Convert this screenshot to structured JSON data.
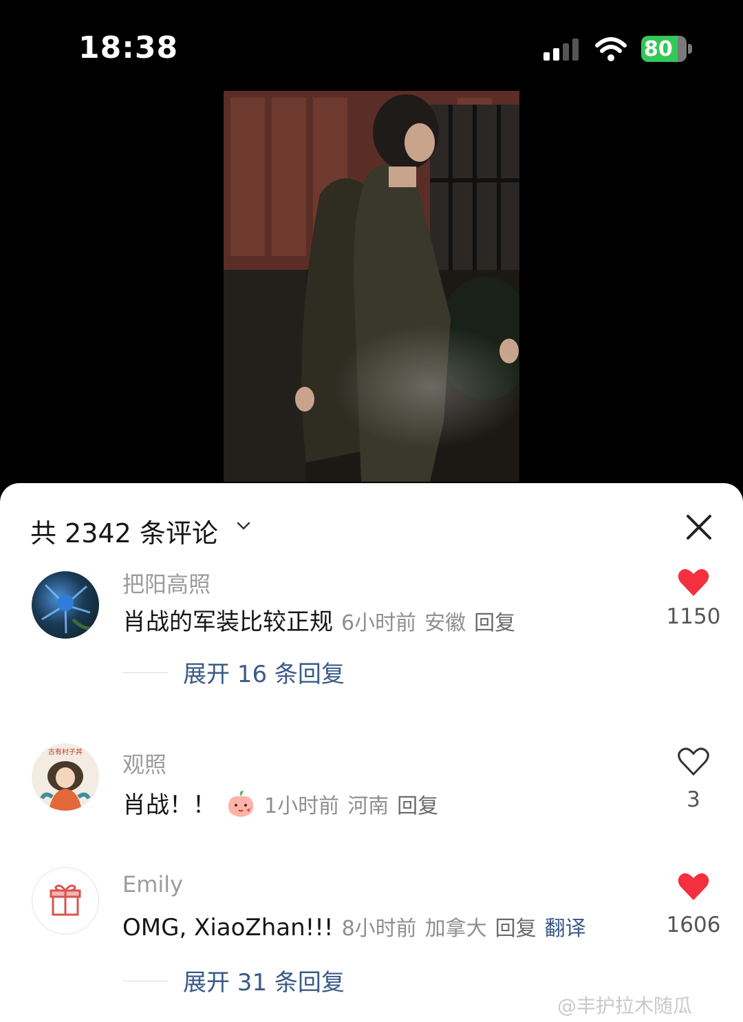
{
  "status_bar": {
    "time": "18:38",
    "battery": "80",
    "battery_level": 0.8
  },
  "panel": {
    "title": "共 2342 条评论"
  },
  "comments": [
    {
      "username": "把阳高照",
      "text": "肖战的军装比较正规",
      "time": "6小时前",
      "location": "安徽",
      "reply": "回复",
      "likes": "1150",
      "liked": true,
      "expand": "展开 16 条回复"
    },
    {
      "username": "观照",
      "text": "肖战！！",
      "time": "1小时前",
      "location": "河南",
      "reply": "回复",
      "likes": "3",
      "liked": false,
      "avatar_caption": "古有村子丼"
    },
    {
      "username": "Emily",
      "text": "OMG, XiaoZhan!!!",
      "time": "8小时前",
      "location": "加拿大",
      "reply": "回复",
      "translate": "翻译",
      "likes": "1606",
      "liked": true,
      "expand": "展开 31 条回复"
    }
  ],
  "watermark": "@丰护拉木随瓜",
  "colors": {
    "like_red": "#f5303e",
    "link_blue": "#3a5a86",
    "battery_green": "#34c759"
  },
  "icons": [
    "signal-icon",
    "wifi-icon",
    "battery-icon",
    "chevron-down-icon",
    "close-icon",
    "heart-filled-icon",
    "heart-outline-icon",
    "gift-icon",
    "peach-emoji-icon"
  ]
}
